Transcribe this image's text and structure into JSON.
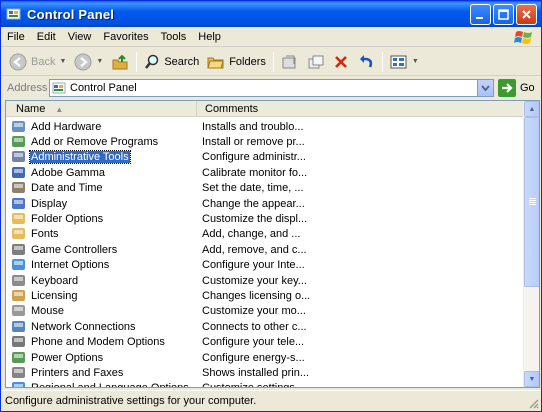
{
  "window": {
    "title": "Control Panel"
  },
  "menu": [
    "File",
    "Edit",
    "View",
    "Favorites",
    "Tools",
    "Help"
  ],
  "toolbar": {
    "back_label": "Back",
    "search_label": "Search",
    "folders_label": "Folders"
  },
  "address": {
    "label": "Address",
    "value": "Control Panel",
    "go_label": "Go"
  },
  "list": {
    "columns": [
      "Name",
      "Comments"
    ],
    "selected_index": 2,
    "items": [
      {
        "name": "Add Hardware",
        "comment": "Installs and troublo...",
        "icon": "hardware-icon",
        "color": "#4f7fb8"
      },
      {
        "name": "Add or Remove Programs",
        "comment": "Install or remove pr...",
        "icon": "add-remove-programs-icon",
        "color": "#3a8a3a"
      },
      {
        "name": "Administrative Tools",
        "comment": "Configure administr...",
        "icon": "administrative-tools-icon",
        "color": "#5a6e9a"
      },
      {
        "name": "Adobe Gamma",
        "comment": "Calibrate monitor fo...",
        "icon": "monitor-icon",
        "color": "#1f4fa6"
      },
      {
        "name": "Date and Time",
        "comment": "Set the date, time, ...",
        "icon": "clock-icon",
        "color": "#7a6a50"
      },
      {
        "name": "Display",
        "comment": "Change the appear...",
        "icon": "display-icon",
        "color": "#2f5fbf"
      },
      {
        "name": "Folder Options",
        "comment": "Customize the displ...",
        "icon": "folder-icon",
        "color": "#e0b040"
      },
      {
        "name": "Fonts",
        "comment": "Add, change, and ...",
        "icon": "fonts-folder-icon",
        "color": "#e0b040"
      },
      {
        "name": "Game Controllers",
        "comment": "Add, remove, and c...",
        "icon": "gamepad-icon",
        "color": "#666666"
      },
      {
        "name": "Internet Options",
        "comment": "Configure your Inte...",
        "icon": "internet-globe-icon",
        "color": "#2a7fd0"
      },
      {
        "name": "Keyboard",
        "comment": "Customize your key...",
        "icon": "keyboard-icon",
        "color": "#777777"
      },
      {
        "name": "Licensing",
        "comment": "Changes licensing o...",
        "icon": "licensing-icon",
        "color": "#c89030"
      },
      {
        "name": "Mouse",
        "comment": "Customize your mo...",
        "icon": "mouse-icon",
        "color": "#888888"
      },
      {
        "name": "Network Connections",
        "comment": "Connects to other c...",
        "icon": "network-icon",
        "color": "#3a70b0"
      },
      {
        "name": "Phone and Modem Options",
        "comment": "Configure your tele...",
        "icon": "phone-icon",
        "color": "#606060"
      },
      {
        "name": "Power Options",
        "comment": "Configure energy-s...",
        "icon": "power-icon",
        "color": "#3a8a3a"
      },
      {
        "name": "Printers and Faxes",
        "comment": "Shows installed prin...",
        "icon": "printer-icon",
        "color": "#707070"
      },
      {
        "name": "Regional and Language Options",
        "comment": "Customize settings ...",
        "icon": "globe-icon",
        "color": "#2a7fd0"
      }
    ]
  },
  "status": {
    "text": "Configure administrative settings for your computer."
  },
  "colors": {
    "titlebar": "#0058ee",
    "selection": "#316ac5",
    "chrome": "#ece9d8"
  }
}
